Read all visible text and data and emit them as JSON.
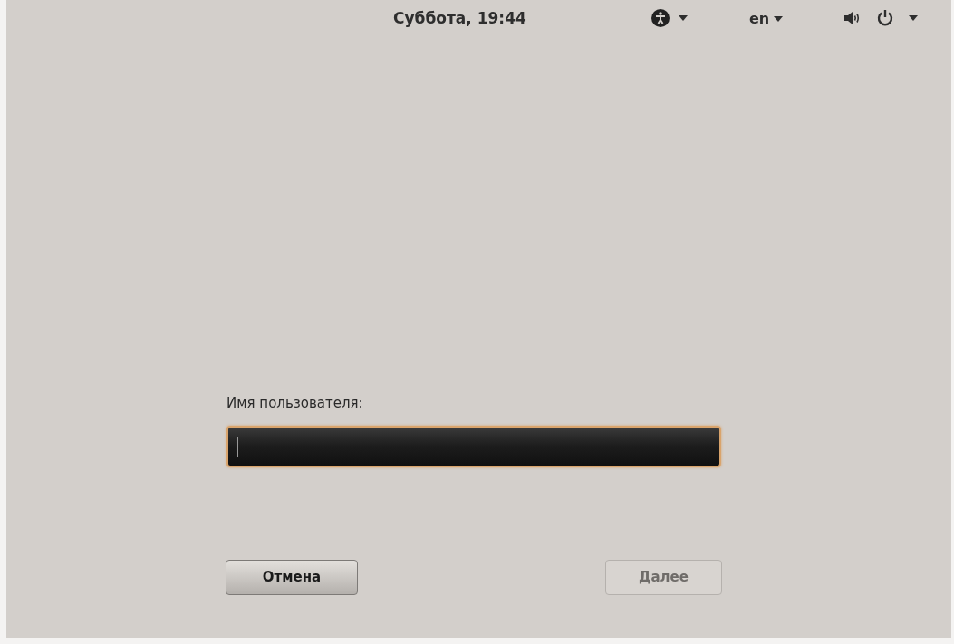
{
  "top_bar": {
    "clock": "Суббота, 19:44",
    "language": "en"
  },
  "login": {
    "label": "Имя пользователя:",
    "username_field": {
      "focused": true
    },
    "buttons": [
      {
        "label": "Отмена",
        "disabled": false
      },
      {
        "label": "Далее",
        "disabled": true
      }
    ]
  }
}
